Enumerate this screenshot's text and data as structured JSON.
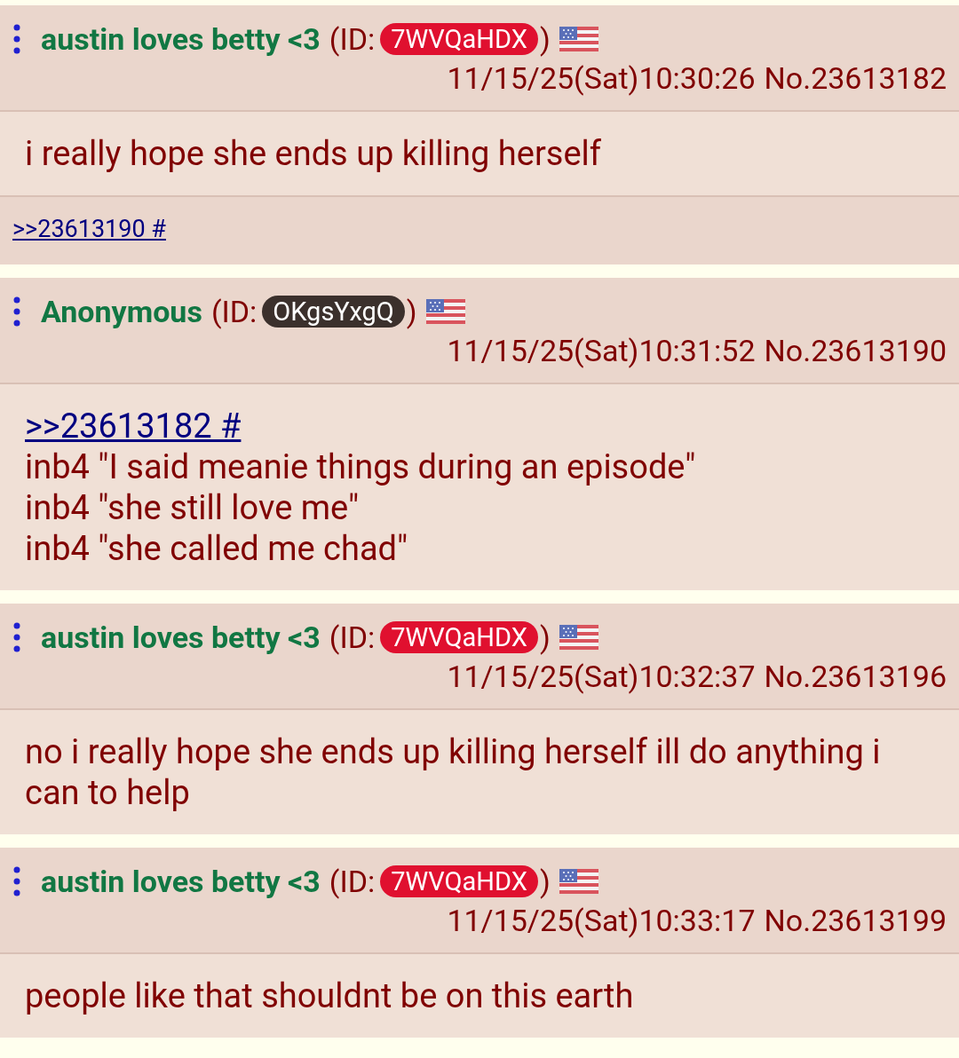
{
  "posts": [
    {
      "name": "austin loves betty <3",
      "id_open": "(ID:",
      "poster_id": "7WVQaHDX",
      "color": "#e0102f",
      "id_close": ")",
      "date": "11/15/25(Sat)10:30:26",
      "number": "No.23613182",
      "body": [
        {
          "kind": "text",
          "text": "i really hope she ends up killing herself"
        }
      ],
      "backlinks": [
        ">>23613190 #"
      ]
    },
    {
      "name": "Anonymous",
      "id_open": "(ID:",
      "poster_id": "OKgsYxgQ",
      "color": "#3b302c",
      "id_close": ")",
      "date": "11/15/25(Sat)10:31:52",
      "number": "No.23613190",
      "body": [
        {
          "kind": "quote_link",
          "text": ">>23613182 #"
        },
        {
          "kind": "text",
          "text": "inb4 \"I said meanie things during an episode\""
        },
        {
          "kind": "text",
          "text": "inb4 \"she still love me\""
        },
        {
          "kind": "text",
          "text": "inb4 \"she called me chad\""
        }
      ]
    },
    {
      "name": "austin loves betty <3",
      "id_open": "(ID:",
      "poster_id": "7WVQaHDX",
      "color": "#e0102f",
      "id_close": ")",
      "date": "11/15/25(Sat)10:32:37",
      "number": "No.23613196",
      "body": [
        {
          "kind": "text",
          "text": "no i really hope she ends up killing herself ill do anything i can to help"
        }
      ]
    },
    {
      "name": "austin loves betty <3",
      "id_open": "(ID:",
      "poster_id": "7WVQaHDX",
      "color": "#e0102f",
      "id_close": ")",
      "date": "11/15/25(Sat)10:33:17",
      "number": "No.23613199",
      "body": [
        {
          "kind": "text",
          "text": "people like that shouldnt be on this earth"
        }
      ]
    }
  ]
}
